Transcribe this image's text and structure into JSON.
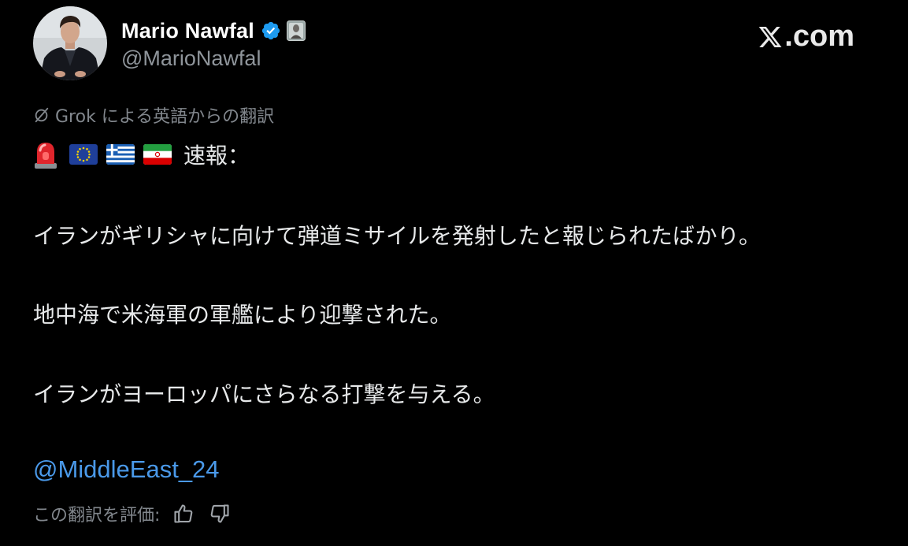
{
  "author": {
    "display_name": "Mario Nawfal",
    "handle": "@MarioNawfal",
    "verified_icon": "verified-badge-icon",
    "affiliate_icon": "affiliate-badge-icon"
  },
  "brand": {
    "label": ".com",
    "logo_icon": "x-logo-icon"
  },
  "translation": {
    "label": "Grok による英語からの翻訳",
    "icon": "grok-icon"
  },
  "post": {
    "emoji": [
      "rotating-light-icon",
      "eu-flag-icon",
      "greece-flag-icon",
      "iran-flag-icon"
    ],
    "headline": "速報：",
    "paragraphs": [
      "イランがギリシャに向けて弾道ミサイルを発射したと報じられたばかり。",
      "地中海で米海軍の軍艦により迎撃された。",
      "イランがヨーロッパにさらなる打撃を与える。"
    ],
    "mention": "@MiddleEast_24"
  },
  "rating": {
    "label": "この翻訳を評価:",
    "thumbs_up_icon": "thumbs-up-icon",
    "thumbs_down_icon": "thumbs-down-icon"
  },
  "colors": {
    "background": "#000000",
    "text": "#e7e9ea",
    "muted": "#82878d",
    "link": "#4a99e9",
    "verified": "#1d9bf0"
  }
}
